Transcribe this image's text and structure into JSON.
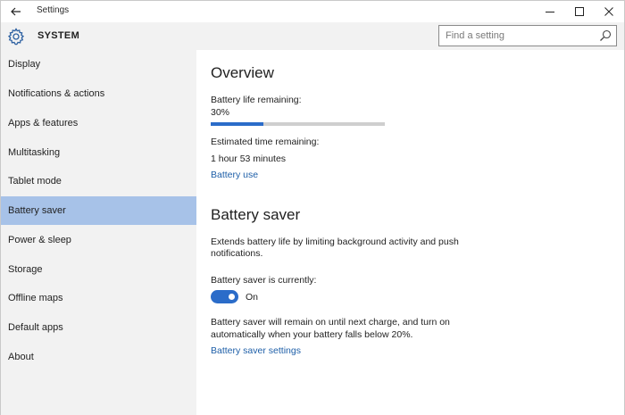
{
  "window": {
    "title": "Settings"
  },
  "header": {
    "section_title": "SYSTEM",
    "search_placeholder": "Find a setting"
  },
  "sidebar": {
    "items": [
      {
        "label": "Display"
      },
      {
        "label": "Notifications & actions"
      },
      {
        "label": "Apps & features"
      },
      {
        "label": "Multitasking"
      },
      {
        "label": "Tablet mode"
      },
      {
        "label": "Battery saver",
        "selected": true
      },
      {
        "label": "Power & sleep"
      },
      {
        "label": "Storage"
      },
      {
        "label": "Offline maps"
      },
      {
        "label": "Default apps"
      },
      {
        "label": "About"
      }
    ]
  },
  "overview": {
    "heading": "Overview",
    "battery_label": "Battery life remaining:",
    "battery_value": "30%",
    "battery_fraction": 0.3,
    "estimated_label": "Estimated time remaining:",
    "estimated_value": "1 hour 53 minutes",
    "battery_use_link": "Battery use"
  },
  "battery_saver": {
    "heading": "Battery saver",
    "description_line1": "Extends battery life by limiting background activity and push",
    "description_line2": "notifications.",
    "status_label": "Battery saver is currently:",
    "toggle_state": "On",
    "toggle_on": true,
    "note_line1": "Battery saver will remain on until next charge, and turn on",
    "note_line2": "automatically when your battery falls below 20%.",
    "settings_link": "Battery saver settings"
  },
  "colors": {
    "accent": "#2b6cc9",
    "selected_nav": "#a7c2e8",
    "link": "#1e5fa8",
    "sidebar_bg": "#f2f2f2"
  }
}
